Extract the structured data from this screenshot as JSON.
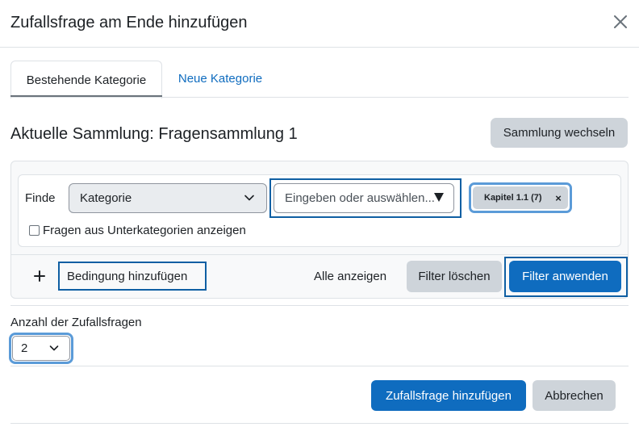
{
  "modal": {
    "title": "Zufallsfrage am Ende hinzufügen",
    "close_icon": "close-icon"
  },
  "tabs": [
    {
      "label": "Bestehende Kategorie",
      "active": true
    },
    {
      "label": "Neue Kategorie",
      "active": false
    }
  ],
  "collection": {
    "title": "Aktuelle Sammlung: Fragensammlung 1",
    "switch_label": "Sammlung wechseln"
  },
  "filter": {
    "find_label": "Finde",
    "category_select_value": "Kategorie",
    "search_placeholder": "Eingeben oder auswählen...",
    "selected_tag": "Kapitel 1.1 (7)",
    "tag_remove_symbol": "×",
    "subcategories_label": "Fragen aus Unterkategorien anzeigen",
    "subcategories_checked": false,
    "add_condition_label": "Bedingung hinzufügen",
    "show_all_label": "Alle anzeigen",
    "clear_label": "Filter löschen",
    "apply_label": "Filter anwenden"
  },
  "quantity": {
    "label": "Anzahl der Zufallsfragen",
    "value": "2"
  },
  "footer": {
    "add_label": "Zufallsfrage hinzufügen",
    "cancel_label": "Abbrechen"
  },
  "colors": {
    "primary": "#0f6cbf",
    "secondary": "#ced4da",
    "focus_ring": "#0f5fa3",
    "text": "#1d2125"
  }
}
